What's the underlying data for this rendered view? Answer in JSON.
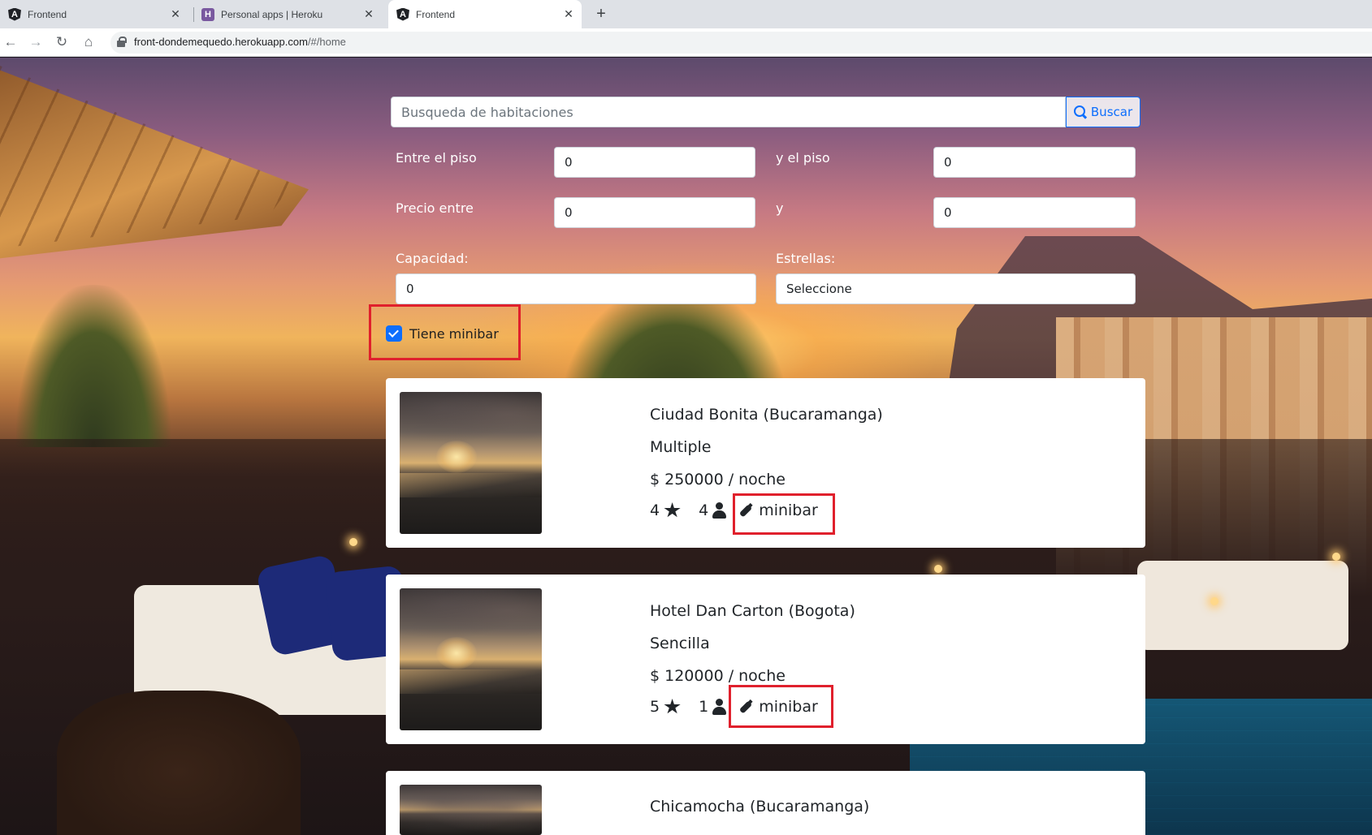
{
  "browser": {
    "tabs": [
      {
        "title": "Frontend",
        "active": false,
        "icon": "angular-icon"
      },
      {
        "title": "Personal apps | Heroku",
        "active": false,
        "icon": "heroku-icon"
      },
      {
        "title": "Frontend",
        "active": true,
        "icon": "angular-icon"
      }
    ],
    "new_tab": "+",
    "url_host": "front-dondemequedo.herokuapp.com",
    "url_path": "/#/home"
  },
  "search": {
    "placeholder": "Busqueda de habitaciones",
    "button_label": "Buscar"
  },
  "filters": {
    "floor_from_label": "Entre el piso",
    "floor_from_value": "0",
    "floor_to_label": "y el piso",
    "floor_to_value": "0",
    "price_from_label": "Precio entre",
    "price_from_value": "0",
    "price_to_label": "y",
    "price_to_value": "0",
    "capacity_label": "Capacidad:",
    "capacity_value": "0",
    "stars_label": "Estrellas:",
    "stars_value": "Seleccione",
    "minibar_label": "Tiene minibar",
    "minibar_checked": true
  },
  "results": [
    {
      "name": "Ciudad Bonita (Bucaramanga)",
      "type": "Multiple",
      "price": "$ 250000 / noche",
      "stars": "4",
      "capacity": "4",
      "minibar": "minibar"
    },
    {
      "name": "Hotel Dan Carton (Bogota)",
      "type": "Sencilla",
      "price": "$ 120000 / noche",
      "stars": "5",
      "capacity": "1",
      "minibar": "minibar"
    },
    {
      "name": "Chicamocha (Bucaramanga)"
    }
  ],
  "colors": {
    "accent": "#0d6efd",
    "highlight_box": "#e0202c"
  }
}
